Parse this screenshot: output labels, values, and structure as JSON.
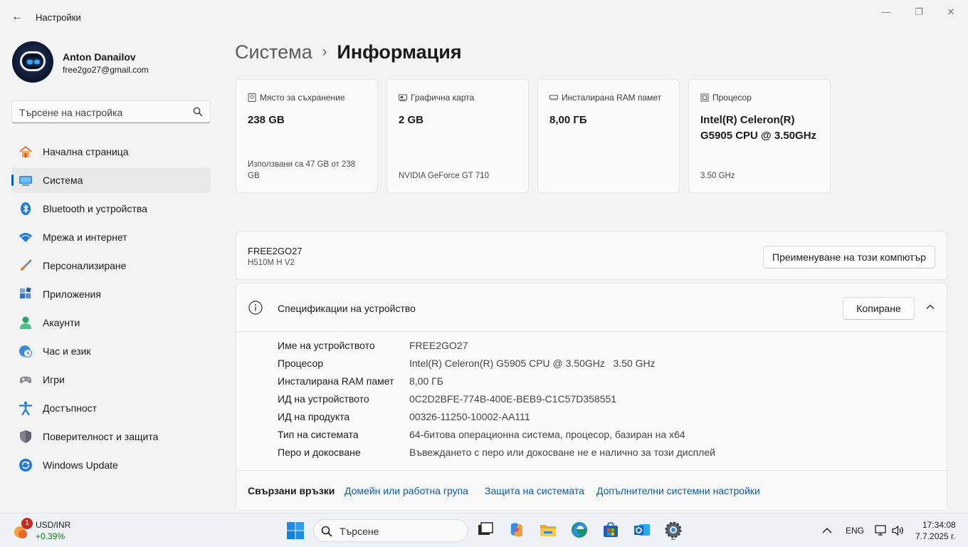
{
  "window": {
    "app_title": "Настройки",
    "back_glyph": "←",
    "minimize_glyph": "—",
    "maximize_glyph": "❐",
    "close_glyph": "✕"
  },
  "profile": {
    "name": "Anton Danailov",
    "email": "free2go27@gmail.com"
  },
  "search": {
    "placeholder": "Търсене на настройка"
  },
  "sidebar": {
    "items": [
      {
        "label": "Начална страница",
        "icon": "home-icon"
      },
      {
        "label": "Система",
        "icon": "system-icon",
        "active": true
      },
      {
        "label": "Bluetooth и устройства",
        "icon": "bluetooth-icon"
      },
      {
        "label": "Мрежа и интернет",
        "icon": "wifi-icon"
      },
      {
        "label": "Персонализиране",
        "icon": "brush-icon"
      },
      {
        "label": "Приложения",
        "icon": "apps-icon"
      },
      {
        "label": "Акаунти",
        "icon": "accounts-icon"
      },
      {
        "label": "Час и език",
        "icon": "clock-globe-icon"
      },
      {
        "label": "Игри",
        "icon": "gamepad-icon"
      },
      {
        "label": "Достъпност",
        "icon": "accessibility-icon"
      },
      {
        "label": "Поверителност и защита",
        "icon": "shield-icon"
      },
      {
        "label": "Windows Update",
        "icon": "windows-update-icon"
      }
    ]
  },
  "breadcrumb": {
    "parent": "Система",
    "separator": "›",
    "current": "Информация"
  },
  "cards": [
    {
      "title": "Място за съхранение",
      "value": "238 GB",
      "sub": "Използвани са 47 GB от 238 GB",
      "icon": "storage-icon"
    },
    {
      "title": "Графична карта",
      "value": "2 GB",
      "sub": "NVIDIA GeForce GT 710",
      "icon": "gpu-icon"
    },
    {
      "title": "Инсталирана RAM памет",
      "value": "8,00 ГБ",
      "sub": "",
      "icon": "ram-icon"
    },
    {
      "title": "Процесор",
      "value": "Intel(R) Celeron(R) G5905 CPU @ 3.50GHz",
      "sub": "3.50 GHz",
      "icon": "cpu-icon"
    }
  ],
  "pc": {
    "name": "FREE2GO27",
    "model": "H510M H V2",
    "rename_label": "Преименуване на този компютър"
  },
  "specs": {
    "title": "Спецификации на устройство",
    "copy_label": "Копиране",
    "rows": [
      {
        "label": "Име на устройството",
        "value": "FREE2GO27"
      },
      {
        "label": "Процесор",
        "value": "Intel(R) Celeron(R) G5905 CPU @ 3.50GHz   3.50 GHz"
      },
      {
        "label": "Инсталирана RAM памет",
        "value": "8,00 ГБ"
      },
      {
        "label": "ИД на устройството",
        "value": "0C2D2BFE-774B-400E-BEB9-C1C57D358551"
      },
      {
        "label": "ИД на продукта",
        "value": "00326-11250-10002-AA111"
      },
      {
        "label": "Тип на системата",
        "value": "64-битова операционна система, процесор, базиран на x64"
      },
      {
        "label": "Перо и докосване",
        "value": "Въвеждането с перо или докосване не е налично за този дисплей"
      }
    ],
    "related_title": "Свързани връзки",
    "related_links": [
      "Домейн или работна група",
      "Защита на системата",
      "Допълнителни системни настройки"
    ]
  },
  "taskbar": {
    "widget_badge": "1",
    "widget_title": "USD/INR",
    "widget_change": "+0.39%",
    "search_label": "Търсене",
    "apps": [
      "task-view-icon",
      "copilot-icon",
      "file-explorer-icon",
      "edge-icon",
      "store-icon",
      "outlook-icon",
      "settings-icon"
    ],
    "language": "ENG",
    "time": "17:34:08",
    "date": "7.7.2025 г."
  },
  "colors": {
    "accent": "#005fb8",
    "link": "#0a5cab",
    "positive": "#0f7b0f",
    "badge": "#c42b1c"
  }
}
